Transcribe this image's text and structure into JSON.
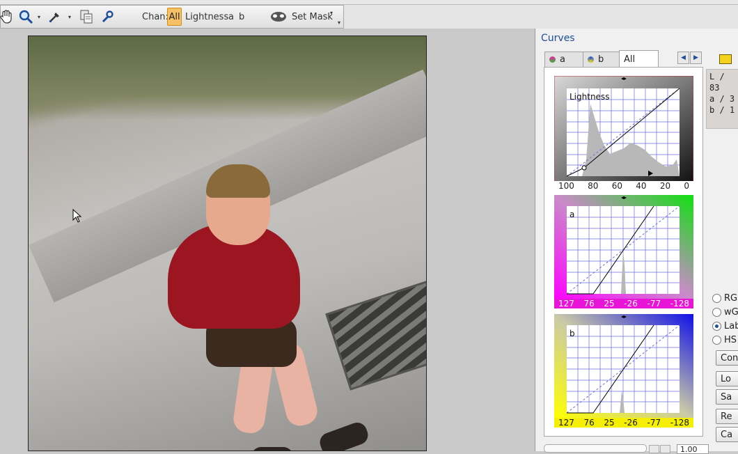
{
  "toolbar": {
    "chan_label": "Chan:",
    "chan_all": "All",
    "chan_lightness": "Lightness",
    "chan_a": "a",
    "chan_b": "b",
    "set_mask": "Set Mask"
  },
  "panel": {
    "title": "Curves",
    "tabs": [
      {
        "label": "a"
      },
      {
        "label": "b"
      },
      {
        "label": "All",
        "active": true
      }
    ],
    "readout": {
      "l": "L /  83",
      "a": "a /   3",
      "b": "b /   1"
    },
    "radios": [
      {
        "label": "RG",
        "selected": false
      },
      {
        "label": "wG",
        "selected": false
      },
      {
        "label": "Lab",
        "selected": true
      },
      {
        "label": "HS",
        "selected": false
      }
    ],
    "buttons": [
      "Con",
      "Lo",
      "Sa",
      "Re",
      "Ca"
    ],
    "bottom_value": "1.00"
  },
  "curves": {
    "lightness": {
      "label": "Lightness",
      "ticks": [
        "100",
        "80",
        "60",
        "40",
        "20",
        "0"
      ]
    },
    "a": {
      "label": "a",
      "ticks": [
        "127",
        "76",
        "25",
        "-26",
        "-77",
        "-128"
      ]
    },
    "b": {
      "label": "b",
      "ticks": [
        "127",
        "76",
        "25",
        "-26",
        "-77",
        "-128"
      ]
    }
  },
  "colors": {
    "accent": "#1d4e9a",
    "chan_active": "#f6c066",
    "grid": "#6b6bdc"
  }
}
